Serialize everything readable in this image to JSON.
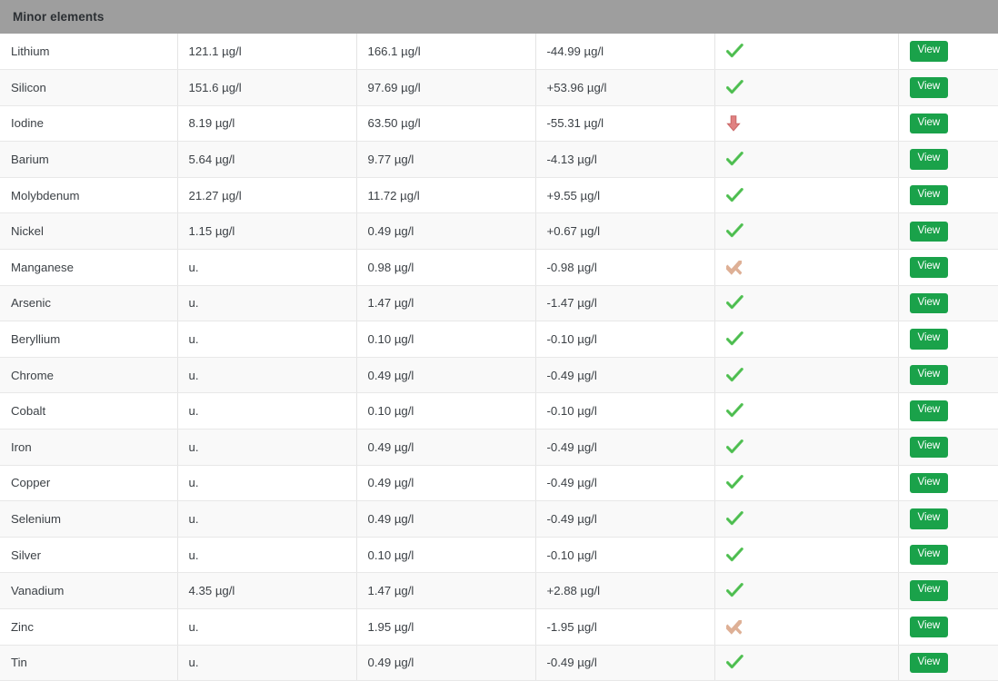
{
  "panel": {
    "title": "Minor elements",
    "header_bg": "#9e9e9e"
  },
  "colors": {
    "header_bg": "#9e9e9e",
    "row_odd": "#ffffff",
    "row_even": "#f9f9f9",
    "border": "#e8e8e8",
    "button_green": "#1aa24a",
    "icon_check_green": "#4cbf56",
    "icon_arrow_red": "#dd7272",
    "icon_faded_tan": "#d9a288",
    "text": "#3c4146"
  },
  "buttons": {
    "view_label": "View"
  },
  "table": {
    "rows": [
      {
        "name": "Lithium",
        "value1": "121.1 µg/l",
        "value2": "166.1 µg/l",
        "diff": "-44.99 µg/l",
        "status": "check",
        "action": "View"
      },
      {
        "name": "Silicon",
        "value1": "151.6 µg/l",
        "value2": "97.69 µg/l",
        "diff": "+53.96 µg/l",
        "status": "check",
        "action": "View"
      },
      {
        "name": "Iodine",
        "value1": "8.19 µg/l",
        "value2": "63.50 µg/l",
        "diff": "-55.31 µg/l",
        "status": "down",
        "action": "View"
      },
      {
        "name": "Barium",
        "value1": "5.64 µg/l",
        "value2": "9.77 µg/l",
        "diff": "-4.13 µg/l",
        "status": "check",
        "action": "View"
      },
      {
        "name": "Molybdenum",
        "value1": "21.27 µg/l",
        "value2": "11.72 µg/l",
        "diff": "+9.55 µg/l",
        "status": "check",
        "action": "View"
      },
      {
        "name": "Nickel",
        "value1": "1.15 µg/l",
        "value2": "0.49 µg/l",
        "diff": "+0.67 µg/l",
        "status": "check",
        "action": "View"
      },
      {
        "name": "Manganese",
        "value1": "u.",
        "value2": "0.98 µg/l",
        "diff": "-0.98 µg/l",
        "status": "faded",
        "action": "View"
      },
      {
        "name": "Arsenic",
        "value1": "u.",
        "value2": "1.47 µg/l",
        "diff": "-1.47 µg/l",
        "status": "check",
        "action": "View"
      },
      {
        "name": "Beryllium",
        "value1": "u.",
        "value2": "0.10 µg/l",
        "diff": "-0.10 µg/l",
        "status": "check",
        "action": "View"
      },
      {
        "name": "Chrome",
        "value1": "u.",
        "value2": "0.49 µg/l",
        "diff": "-0.49 µg/l",
        "status": "check",
        "action": "View"
      },
      {
        "name": "Cobalt",
        "value1": "u.",
        "value2": "0.10 µg/l",
        "diff": "-0.10 µg/l",
        "status": "check",
        "action": "View"
      },
      {
        "name": "Iron",
        "value1": "u.",
        "value2": "0.49 µg/l",
        "diff": "-0.49 µg/l",
        "status": "check",
        "action": "View"
      },
      {
        "name": "Copper",
        "value1": "u.",
        "value2": "0.49 µg/l",
        "diff": "-0.49 µg/l",
        "status": "check",
        "action": "View"
      },
      {
        "name": "Selenium",
        "value1": "u.",
        "value2": "0.49 µg/l",
        "diff": "-0.49 µg/l",
        "status": "check",
        "action": "View"
      },
      {
        "name": "Silver",
        "value1": "u.",
        "value2": "0.10 µg/l",
        "diff": "-0.10 µg/l",
        "status": "check",
        "action": "View"
      },
      {
        "name": "Vanadium",
        "value1": "4.35 µg/l",
        "value2": "1.47 µg/l",
        "diff": "+2.88 µg/l",
        "status": "check",
        "action": "View"
      },
      {
        "name": "Zinc",
        "value1": "u.",
        "value2": "1.95 µg/l",
        "diff": "-1.95 µg/l",
        "status": "faded",
        "action": "View"
      },
      {
        "name": "Tin",
        "value1": "u.",
        "value2": "0.49 µg/l",
        "diff": "-0.49 µg/l",
        "status": "check",
        "action": "View"
      }
    ]
  },
  "icons": {
    "check": "green-check-icon",
    "down": "red-down-arrow-icon",
    "faded": "faded-check-icon"
  }
}
